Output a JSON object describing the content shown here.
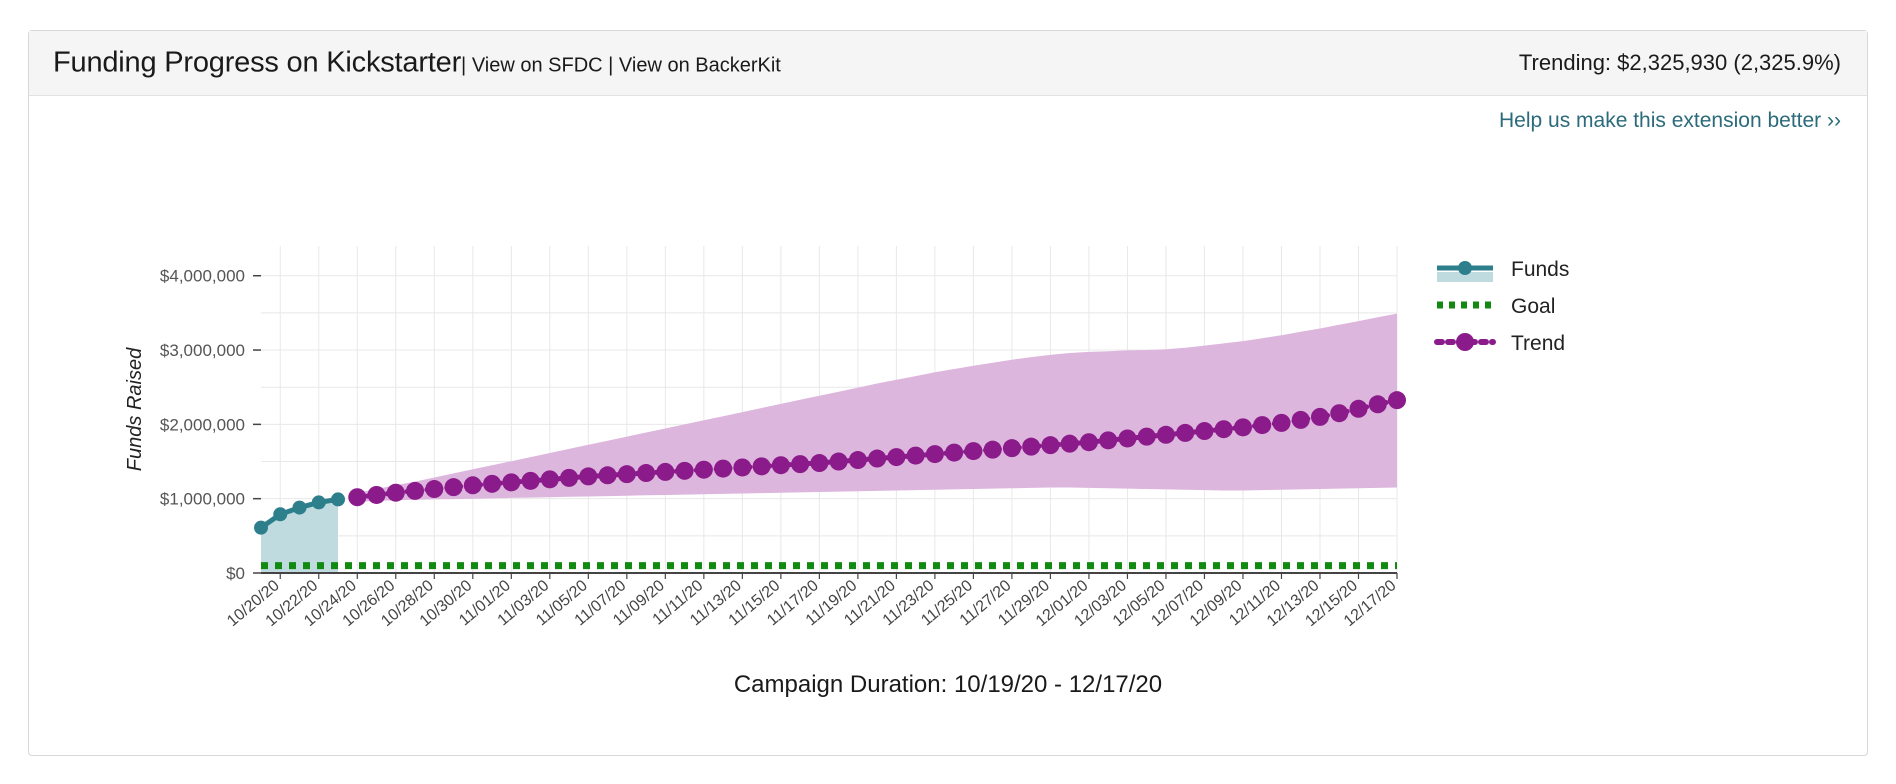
{
  "header": {
    "title": "Funding Progress on Kickstarter",
    "separator1": "| ",
    "link_sfdc": "View on SFDC",
    "separator2": " | ",
    "link_backerkit": "View on BackerKit",
    "trending": "Trending: $2,325,930 (2,325.9%)"
  },
  "help": {
    "label": "Help us make this extension better ››",
    "color": "#2b6b7b"
  },
  "footer": {
    "caption": "Campaign Duration: 10/19/20 - 12/17/20"
  },
  "colors": {
    "funds_line": "#2d7f8c",
    "funds_fill": "#bfdbe0",
    "goal_line": "#128a12",
    "trend_line": "#8b1a8b",
    "trend_band": "#ddb6dd",
    "axis": "#444444",
    "grid": "#e8e8e8",
    "header_bg": "#f5f5f5",
    "card_border": "#d8d8d8"
  },
  "chart_data": {
    "type": "line",
    "title": "Funding Progress on Kickstarter",
    "xlabel": "",
    "ylabel": "Funds Raised",
    "ylim": [
      0,
      4400000
    ],
    "yticks": [
      0,
      1000000,
      2000000,
      3000000,
      4000000
    ],
    "ytick_labels": [
      "$0",
      "$1,000,000",
      "$2,000,000",
      "$3,000,000",
      "$4,000,000"
    ],
    "grid": true,
    "legend_position": "right",
    "x": [
      "10/19/20",
      "10/20/20",
      "10/21/20",
      "10/22/20",
      "10/23/20",
      "10/24/20",
      "10/25/20",
      "10/26/20",
      "10/27/20",
      "10/28/20",
      "10/29/20",
      "10/30/20",
      "10/31/20",
      "11/01/20",
      "11/02/20",
      "11/03/20",
      "11/04/20",
      "11/05/20",
      "11/06/20",
      "11/07/20",
      "11/08/20",
      "11/09/20",
      "11/10/20",
      "11/11/20",
      "11/12/20",
      "11/13/20",
      "11/14/20",
      "11/15/20",
      "11/16/20",
      "11/17/20",
      "11/18/20",
      "11/19/20",
      "11/20/20",
      "11/21/20",
      "11/22/20",
      "11/23/20",
      "11/24/20",
      "11/25/20",
      "11/26/20",
      "11/27/20",
      "11/28/20",
      "11/29/20",
      "11/30/20",
      "12/01/20",
      "12/02/20",
      "12/03/20",
      "12/04/20",
      "12/05/20",
      "12/06/20",
      "12/07/20",
      "12/08/20",
      "12/09/20",
      "12/10/20",
      "12/11/20",
      "12/12/20",
      "12/13/20",
      "12/14/20",
      "12/15/20",
      "12/16/20",
      "12/17/20"
    ],
    "xtick_labels": [
      "10/20/20",
      "10/22/20",
      "10/24/20",
      "10/26/20",
      "10/28/20",
      "10/30/20",
      "11/01/20",
      "11/03/20",
      "11/05/20",
      "11/07/20",
      "11/09/20",
      "11/11/20",
      "11/13/20",
      "11/15/20",
      "11/17/20",
      "11/19/20",
      "11/21/20",
      "11/23/20",
      "11/25/20",
      "11/27/20",
      "11/29/20",
      "12/01/20",
      "12/03/20",
      "12/05/20",
      "12/07/20",
      "12/09/20",
      "12/11/20",
      "12/13/20",
      "12/15/20",
      "12/17/20"
    ],
    "series": [
      {
        "name": "Funds",
        "type": "line-area",
        "color": "#2d7f8c",
        "fill": "#bfdbe0",
        "x": [
          "10/19/20",
          "10/20/20",
          "10/21/20",
          "10/22/20",
          "10/23/20"
        ],
        "values": [
          610000,
          790000,
          880000,
          950000,
          990000
        ]
      },
      {
        "name": "Goal",
        "type": "dotted-line",
        "color": "#128a12",
        "value": 100000
      },
      {
        "name": "Trend",
        "type": "dotted-line-markers",
        "color": "#8b1a8b",
        "x": [
          "10/24/20",
          "10/25/20",
          "10/26/20",
          "10/27/20",
          "10/28/20",
          "10/29/20",
          "10/30/20",
          "10/31/20",
          "11/01/20",
          "11/02/20",
          "11/03/20",
          "11/04/20",
          "11/05/20",
          "11/06/20",
          "11/07/20",
          "11/08/20",
          "11/09/20",
          "11/10/20",
          "11/11/20",
          "11/12/20",
          "11/13/20",
          "11/14/20",
          "11/15/20",
          "11/16/20",
          "11/17/20",
          "11/18/20",
          "11/19/20",
          "11/20/20",
          "11/21/20",
          "11/22/20",
          "11/23/20",
          "11/24/20",
          "11/25/20",
          "11/26/20",
          "11/27/20",
          "11/28/20",
          "11/29/20",
          "11/30/20",
          "12/01/20",
          "12/02/20",
          "12/03/20",
          "12/04/20",
          "12/05/20",
          "12/06/20",
          "12/07/20",
          "12/08/20",
          "12/09/20",
          "12/10/20",
          "12/11/20",
          "12/12/20",
          "12/13/20",
          "12/14/20",
          "12/15/20",
          "12/16/20",
          "12/17/20"
        ],
        "values": [
          1020000,
          1050000,
          1080000,
          1105000,
          1130000,
          1155000,
          1180000,
          1200000,
          1220000,
          1240000,
          1260000,
          1280000,
          1300000,
          1315000,
          1330000,
          1345000,
          1360000,
          1375000,
          1390000,
          1405000,
          1420000,
          1435000,
          1450000,
          1465000,
          1480000,
          1500000,
          1520000,
          1540000,
          1560000,
          1580000,
          1600000,
          1620000,
          1640000,
          1660000,
          1680000,
          1700000,
          1720000,
          1740000,
          1760000,
          1785000,
          1810000,
          1835000,
          1860000,
          1885000,
          1910000,
          1935000,
          1960000,
          1990000,
          2020000,
          2060000,
          2100000,
          2150000,
          2210000,
          2270000,
          2325930
        ],
        "band_upper": [
          1080000,
          1130000,
          1180000,
          1230000,
          1285000,
          1340000,
          1395000,
          1450000,
          1505000,
          1560000,
          1615000,
          1670000,
          1725000,
          1780000,
          1835000,
          1890000,
          1945000,
          2000000,
          2055000,
          2110000,
          2165000,
          2220000,
          2275000,
          2330000,
          2385000,
          2440000,
          2495000,
          2550000,
          2600000,
          2650000,
          2700000,
          2745000,
          2790000,
          2830000,
          2870000,
          2905000,
          2935000,
          2960000,
          2975000,
          2985000,
          2995000,
          3000000,
          3010000,
          3030000,
          3060000,
          3090000,
          3120000,
          3160000,
          3200000,
          3245000,
          3290000,
          3340000,
          3390000,
          3440000,
          3490000
        ],
        "band_lower": [
          960000,
          970000,
          980000,
          985000,
          990000,
          995000,
          1000000,
          1005000,
          1010000,
          1015000,
          1020000,
          1025000,
          1030000,
          1035000,
          1040000,
          1045000,
          1050000,
          1055000,
          1060000,
          1065000,
          1070000,
          1075000,
          1080000,
          1085000,
          1090000,
          1095000,
          1100000,
          1105000,
          1110000,
          1115000,
          1120000,
          1125000,
          1130000,
          1135000,
          1140000,
          1145000,
          1150000,
          1150000,
          1145000,
          1140000,
          1135000,
          1130000,
          1125000,
          1120000,
          1115000,
          1110000,
          1110000,
          1115000,
          1120000,
          1125000,
          1130000,
          1135000,
          1140000,
          1145000,
          1150000
        ]
      }
    ],
    "legend": [
      {
        "label": "Funds",
        "color": "#2d7f8c",
        "style": "line-marker-area"
      },
      {
        "label": "Goal",
        "color": "#128a12",
        "style": "dotted"
      },
      {
        "label": "Trend",
        "color": "#8b1a8b",
        "style": "dotted-marker"
      }
    ]
  }
}
